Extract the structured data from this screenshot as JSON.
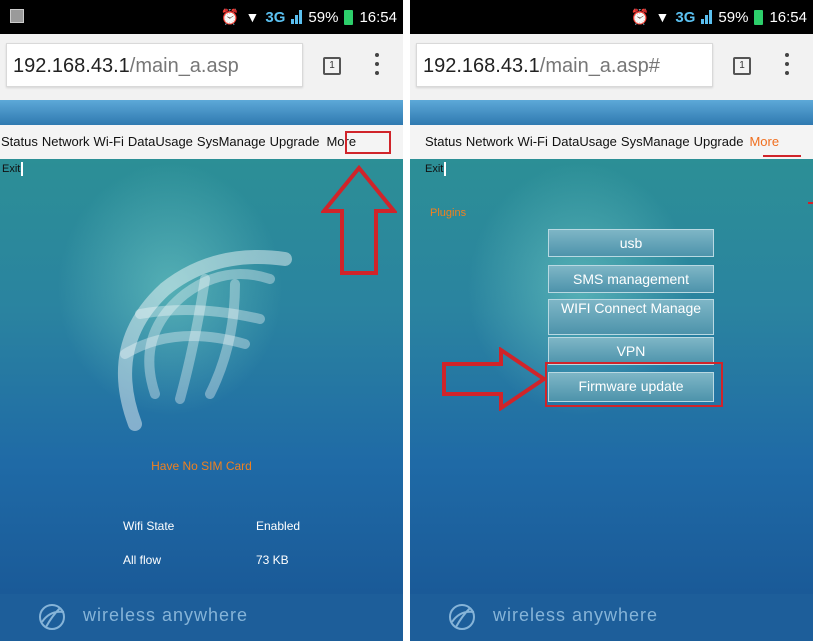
{
  "left": {
    "status": {
      "time": "16:54",
      "battery": "59%",
      "network": "3G"
    },
    "url": {
      "host": "192.168.43.1",
      "path": "/main_a.asp"
    },
    "tab_count": "1",
    "nav": [
      "Status",
      "Network",
      "Wi-Fi",
      "DataUsage",
      "SysManage",
      "Upgrade",
      "More"
    ],
    "exit_label": "Exit",
    "sim_status": "Have No SIM Card",
    "info": [
      {
        "label": "Wifi State",
        "value": "Enabled"
      },
      {
        "label": "All flow",
        "value": "73 KB"
      }
    ],
    "footer": "wireless anywhere"
  },
  "right": {
    "status": {
      "time": "16:54",
      "battery": "59%",
      "network": "3G"
    },
    "url": {
      "host": "192.168.43.1",
      "path": "/main_a.asp#"
    },
    "tab_count": "1",
    "nav": [
      "Status",
      "Network",
      "Wi-Fi",
      "DataUsage",
      "SysManage",
      "Upgrade",
      "More"
    ],
    "active_nav": "More",
    "exit_label": "Exit",
    "plugins_label": "Plugins",
    "plugins": [
      "usb",
      "SMS management",
      "WIFI Connect Manage",
      "VPN",
      "Firmware update"
    ],
    "footer": "wireless anywhere"
  },
  "colors": {
    "accent": "#f06f1f",
    "highlight": "#d0242a",
    "header_blue": "#2f79b0",
    "footer_blue": "#1d5e9a"
  }
}
